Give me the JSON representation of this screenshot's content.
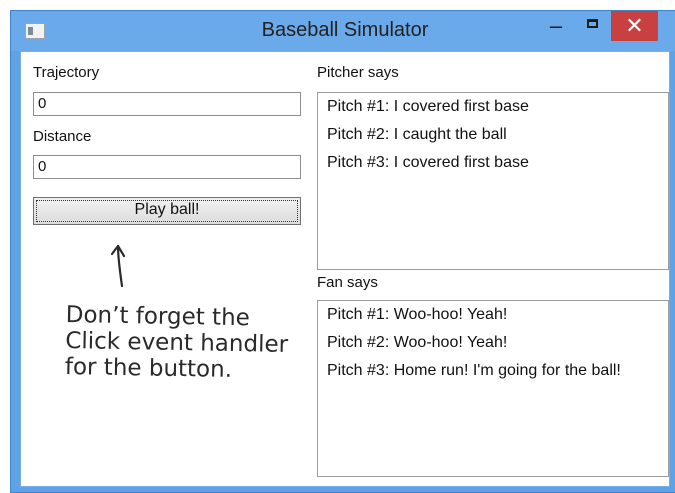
{
  "window": {
    "title": "Baseball Simulator",
    "controls": {
      "minimize": "–",
      "close": "✕"
    }
  },
  "left_panel": {
    "trajectory_label": "Trajectory",
    "trajectory_value": "0",
    "distance_label": "Distance",
    "distance_value": "0",
    "button_label": "Play ball!"
  },
  "pitcher": {
    "label": "Pitcher says",
    "items": [
      "Pitch #1: I covered first base",
      "Pitch #2: I caught the ball",
      "Pitch #3: I covered first base"
    ]
  },
  "fan": {
    "label": "Fan says",
    "items": [
      "Pitch #1: Woo-hoo! Yeah!",
      "Pitch #2: Woo-hoo! Yeah!",
      "Pitch #3: Home run! I'm going for the ball!"
    ]
  },
  "annotation": {
    "lines": [
      "Don’t forget the",
      "Click event handler",
      "for the button."
    ]
  },
  "colors": {
    "title_bar": "#6aa9ea",
    "close_button": "#c84040",
    "window_border": "#3f86d1"
  }
}
